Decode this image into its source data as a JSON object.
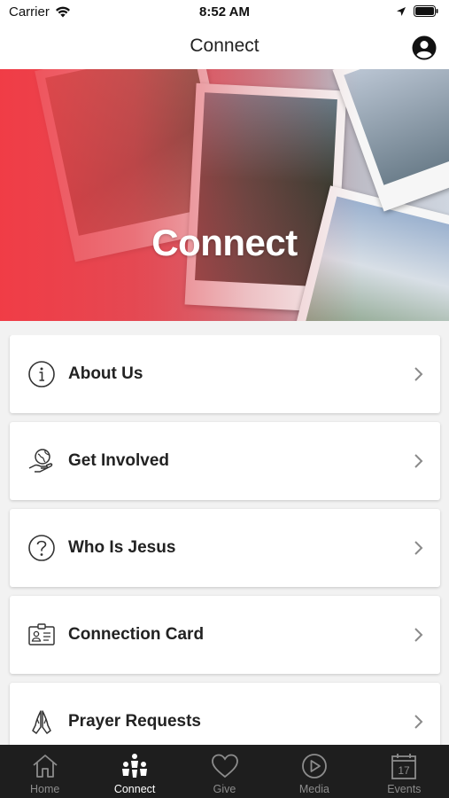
{
  "status_bar": {
    "carrier": "Carrier",
    "time": "8:52 AM"
  },
  "header": {
    "title": "Connect"
  },
  "hero": {
    "title": "Connect"
  },
  "menu": {
    "items": [
      {
        "label": "About Us",
        "icon": "info-icon"
      },
      {
        "label": "Get Involved",
        "icon": "hand-globe-icon"
      },
      {
        "label": "Who Is Jesus",
        "icon": "question-icon"
      },
      {
        "label": "Connection Card",
        "icon": "id-card-icon"
      },
      {
        "label": "Prayer Requests",
        "icon": "praying-hands-icon"
      }
    ]
  },
  "tabs": [
    {
      "label": "Home",
      "icon": "home-icon",
      "active": false
    },
    {
      "label": "Connect",
      "icon": "people-icon",
      "active": true
    },
    {
      "label": "Give",
      "icon": "heart-icon",
      "active": false
    },
    {
      "label": "Media",
      "icon": "play-icon",
      "active": false
    },
    {
      "label": "Events",
      "icon": "calendar-icon",
      "active": false
    }
  ],
  "calendar_day": "17",
  "colors": {
    "accent": "#f0424a",
    "tab_bar": "#1e1e1e",
    "tab_inactive": "#8c8c8c"
  }
}
